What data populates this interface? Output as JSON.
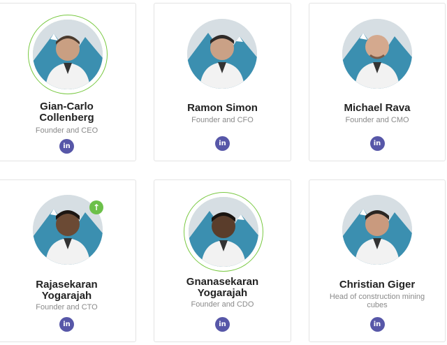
{
  "team": [
    {
      "name": "Gian-Carlo\nCollenberg",
      "name_line1": "Gian-Carlo",
      "name_line2": "Collenberg",
      "role": "Founder and CEO",
      "linkedin": "in"
    },
    {
      "name_line1": "Ramon Simon",
      "name_line2": "",
      "role": "Founder and CFO",
      "linkedin": "in"
    },
    {
      "name_line1": "Michael Rava",
      "name_line2": "",
      "role": "Founder and CMO",
      "linkedin": "in"
    },
    {
      "name_line1": "Rajasekaran",
      "name_line2": "Yogarajah",
      "role": "Founder and CTO",
      "linkedin": "in"
    },
    {
      "name_line1": "Gnanasekaran",
      "name_line2": "Yogarajah",
      "role": "Founder and CDO",
      "linkedin": "in"
    },
    {
      "name_line1": "Christian Giger",
      "name_line2": "",
      "role_line1": "Head of construction mining",
      "role_line2": "cubes",
      "linkedin": "in"
    }
  ],
  "icons": {
    "linkedin": "linkedin-icon",
    "scroll_up": "arrow-up-icon"
  },
  "colors": {
    "linkedin_bg": "#5757a8",
    "highlight_ring": "#7ac943",
    "badge_green": "#6cc04a"
  }
}
